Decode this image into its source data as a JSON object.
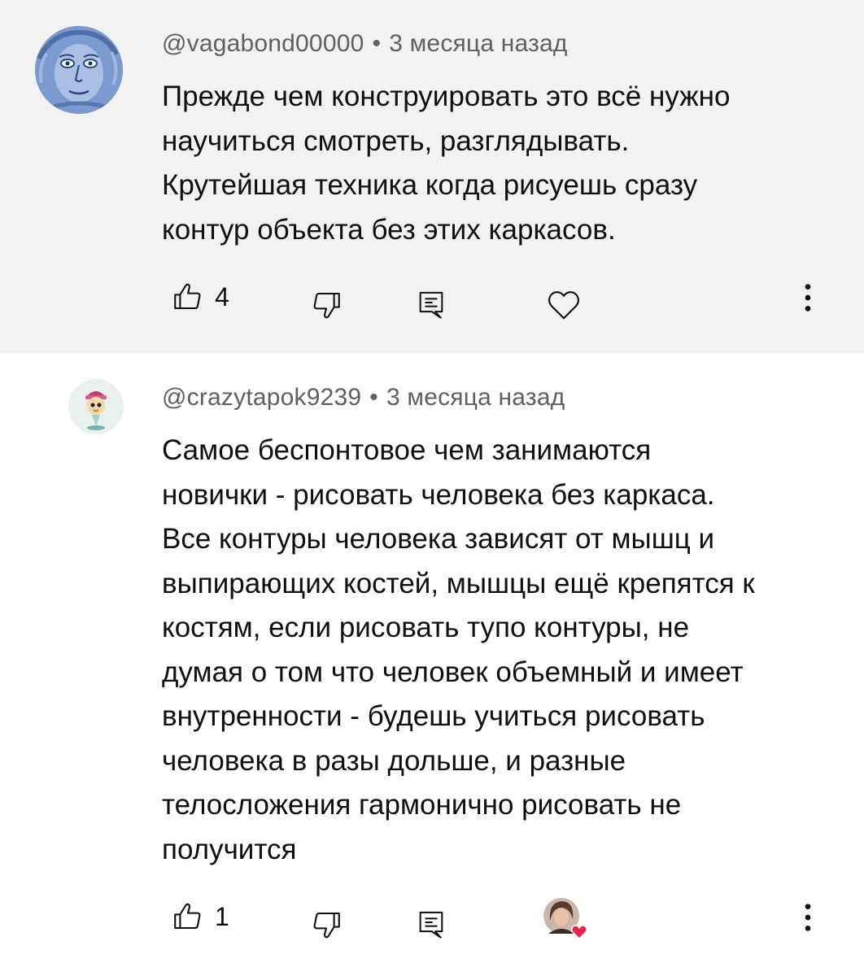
{
  "comments": [
    {
      "author": "@vagabond00000",
      "time": "3 месяца назад",
      "lines": [
        "Прежде чем конструировать это всё нужно",
        "научиться смотреть, разглядывать.",
        "Крутейшая техника когда рисуешь сразу",
        "контур объекта без этих каркасов."
      ],
      "likes": "4",
      "creator_heart": false
    },
    {
      "author": "@crazytapok9239",
      "time": "3 месяца назад",
      "lines": [
        "Самое беспонтовое чем занимаются",
        "новички - рисовать человека без каркаса.",
        "Все контуры человека зависят от мышц и",
        "выпирающих костей, мышцы ещё крепятся к",
        "костям, если рисовать тупо контуры, не",
        "думая о том что человек объемный и имеет",
        "внутренности - будешь учиться рисовать",
        "человека в разы дольше, и разные",
        "телосложения гармонично рисовать не",
        "получится"
      ],
      "likes": "1",
      "creator_heart": true
    }
  ],
  "separator": "•",
  "icons": {
    "like": "thumb-up-icon",
    "dislike": "thumb-down-icon",
    "reply": "reply-icon",
    "heart": "heart-icon",
    "more": "more-vert-icon"
  },
  "colors": {
    "highlight_bg": "#f2f2f2",
    "meta_text": "#606060",
    "heart_red": "#e8264a"
  }
}
